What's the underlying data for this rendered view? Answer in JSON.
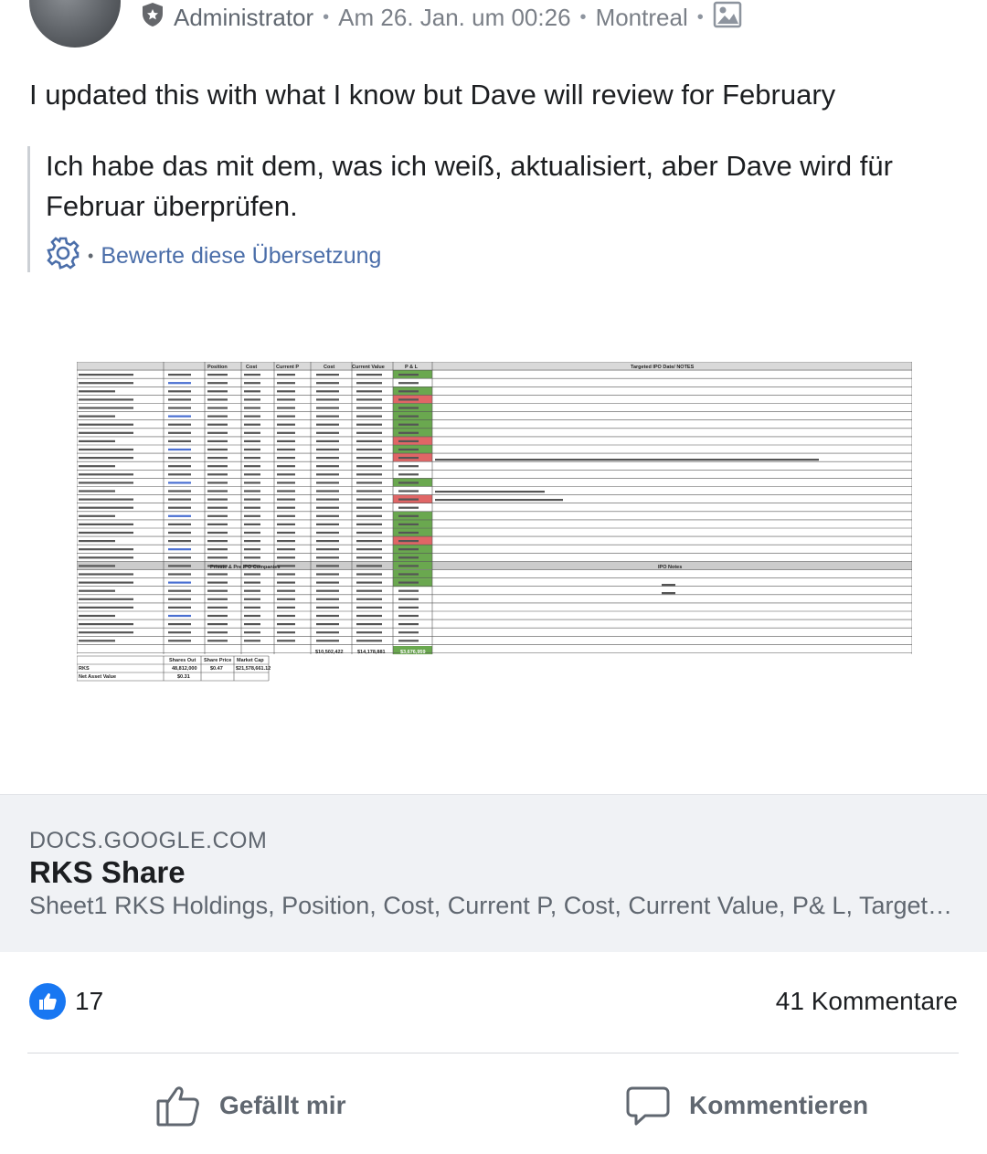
{
  "post": {
    "author_role": "Administrator",
    "date": "Am 26. Jan. um 00:26",
    "location": "Montreal",
    "separator": "•",
    "text": "I updated this with what I know but Dave will review for February",
    "translation": "Ich habe das mit dem, was ich weiß, aktualisiert, aber Dave wird für Februar überprüfen.",
    "rate_translation": "Bewerte diese Übersetzung"
  },
  "spreadsheet": {
    "headers": [
      "Position",
      "Cost",
      "Current P",
      "Cost",
      "Current Value",
      "P & L",
      "Targeted IPO Date/ NOTES"
    ],
    "section_private": "Private & Pre IPO Companies",
    "section_ipo_notes": "IPO Notes",
    "totals": [
      "$10,502,422",
      "$14,178,881",
      "$3,676,959"
    ],
    "shares_headers": [
      "Shares Out",
      "Share Price",
      "Market Cap"
    ],
    "rks_row": [
      "RKS",
      "48,812,000",
      "$0.47",
      "$21,578,661.12"
    ],
    "nav_row": [
      "Net Asset Value",
      "$0.31"
    ]
  },
  "link_card": {
    "domain": "DOCS.GOOGLE.COM",
    "title": "RKS Share",
    "description": "Sheet1 RKS Holdings, Position, Cost, Current P, Cost, Current Value, P& L, Targeted IPO Date/ NOTES"
  },
  "reactions": {
    "likes": "17",
    "comments": "41 Kommentare"
  },
  "actions": {
    "like_label": "Gefällt mir",
    "comment_label": "Kommentieren"
  },
  "colors": {
    "like_blue": "#1877f2",
    "link_blue": "#4b6ea9",
    "pnl_green": "#6aa84f",
    "pnl_red": "#e06666"
  },
  "icons": [
    "shield-star-icon",
    "photo-icon",
    "gear-icon",
    "thumbs-up-icon",
    "comment-icon"
  ]
}
